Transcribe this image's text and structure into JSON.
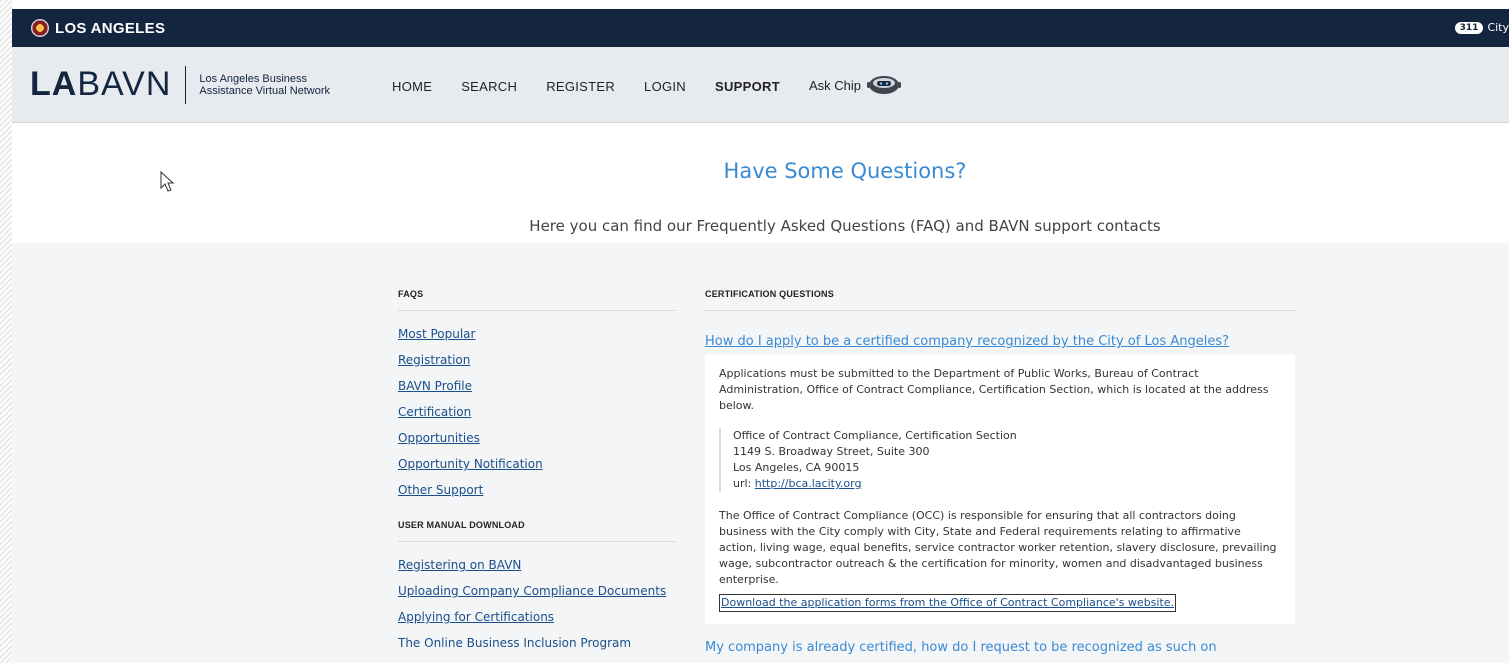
{
  "topbar": {
    "city": "LOS ANGELES",
    "badge": "311",
    "right_text": "City"
  },
  "header": {
    "logo_bold": "LA",
    "logo_thin": "BAVN",
    "subtitle_line1": "Los Angeles Business",
    "subtitle_line2": "Assistance Virtual Network",
    "nav": {
      "home": "HOME",
      "search": "SEARCH",
      "register": "REGISTER",
      "login": "LOGIN",
      "support": "SUPPORT",
      "ask_chip": "Ask Chip"
    }
  },
  "hero": {
    "title": "Have Some Questions?",
    "subtitle": "Here you can find our Frequently Asked Questions (FAQ) and BAVN support contacts"
  },
  "sidebar": {
    "faqs_heading": "FAQS",
    "faqs": [
      "Most Popular",
      "Registration",
      "BAVN Profile",
      "Certification",
      "Opportunities",
      "Opportunity Notification",
      "Other Support"
    ],
    "manual_heading": "USER MANUAL DOWNLOAD",
    "manuals": [
      "Registering on BAVN",
      "Uploading Company Compliance Documents",
      "Applying for Certifications",
      "The Online Business Inclusion Program"
    ]
  },
  "main": {
    "heading": "CERTIFICATION QUESTIONS",
    "question1": "How do I apply to be a certified company recognized by the City of Los Angeles?",
    "answer_intro": "Applications must be submitted to the Department of Public Works, Bureau of Contract Administration, Office of Contract Compliance, Certification Section, which is located at the address below.",
    "address_line1": "Office of Contract Compliance, Certification Section",
    "address_line2": "1149 S. Broadway Street, Suite 300",
    "address_line3": "Los Angeles, CA 90015",
    "url_label": "url:",
    "url": "http://bca.lacity.org",
    "answer_body": "The Office of Contract Compliance (OCC) is responsible for ensuring that all contractors doing business with the City comply with City, State and Federal requirements relating to affirmative action, living wage, equal benefits, service contractor worker retention, slavery disclosure, prevailing wage, subcontractor outreach & the certification for minority, women and disadvantaged business enterprise.",
    "download_link": "Download the application forms from the Office of Contract Compliance's website.",
    "question2": "My company is already certified, how do I request to be recognized as such on"
  }
}
